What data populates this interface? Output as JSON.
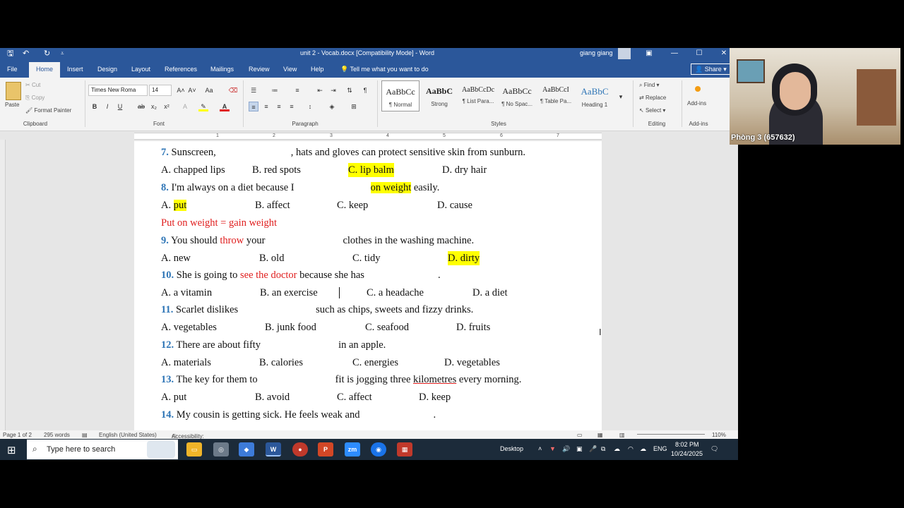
{
  "titlebar": {
    "document_title": "unit 2 - Vocab.docx [Compatibility Mode]  -  Word",
    "user_name": "giang giang",
    "save_icon": "save-icon",
    "undo_icon": "undo-icon",
    "redo_icon": "redo-icon",
    "minimize": "—",
    "maximize": "☐",
    "close": "✕"
  },
  "tabs": [
    "File",
    "Home",
    "Insert",
    "Design",
    "Layout",
    "References",
    "Mailings",
    "Review",
    "View",
    "Help"
  ],
  "tell_me": "Tell me what you want to do",
  "share_label": "Share",
  "ribbon": {
    "clipboard": {
      "paste": "Paste",
      "cut": "Cut",
      "copy": "Copy",
      "format_painter": "Format Painter",
      "group": "Clipboard"
    },
    "font": {
      "name": "Times New Roma",
      "size": "14",
      "group": "Font"
    },
    "paragraph": {
      "group": "Paragraph"
    },
    "styles": {
      "group": "Styles",
      "tiles": [
        {
          "preview": "AaBbCc",
          "name": "¶ Normal"
        },
        {
          "preview": "AaBbC",
          "name": "Strong"
        },
        {
          "preview": "AaBbCcDc",
          "name": "¶ List Para..."
        },
        {
          "preview": "AaBbCc",
          "name": "¶ No Spac..."
        },
        {
          "preview": "AaBbCcI",
          "name": "¶ Table Pa..."
        },
        {
          "preview": "AaBbC",
          "name": "Heading 1"
        }
      ]
    },
    "editing": {
      "find": "Find",
      "replace": "Replace",
      "select": "Select",
      "group": "Editing"
    },
    "addins": {
      "label": "Add-ins",
      "group": "Add-ins"
    }
  },
  "ruler_numbers": [
    "1",
    "2",
    "3",
    "4",
    "5",
    "6",
    "7"
  ],
  "document": {
    "q7": {
      "num": "7.",
      "before": " Sunscreen,",
      "after": ", hats and gloves can protect sensitive skin from sunburn."
    },
    "q7_options": [
      "A. chapped lips",
      "B. red spots",
      "C. lip balm",
      "D. dry hair"
    ],
    "q8": {
      "num": "8.",
      "before": " I'm always on a diet because I",
      "highlight": "on weight",
      "after": " easily."
    },
    "q8_options": {
      "a_prefix": "A. ",
      "a_highlight": "put",
      "b": "B. affect",
      "c": "C. keep",
      "d": "D. cause"
    },
    "note": "Put on weight = gain weight",
    "q9": {
      "num": "9.",
      "before": " You should ",
      "red": "throw",
      "mid": " your",
      "after": "clothes in the washing machine."
    },
    "q9_options": [
      "A. new",
      "B. old",
      "C. tidy",
      "D. dirty"
    ],
    "q10": {
      "num": "10.",
      "before": " She is going to ",
      "red": "see the doctor",
      "after": " because she has",
      "end": "."
    },
    "q10_options": [
      "A. a vitamin",
      "B. an exercise",
      "C. a headache",
      "D. a diet"
    ],
    "q11": {
      "num": "11.",
      "before": " Scarlet dislikes",
      "after": "such as chips, sweets and fizzy drinks."
    },
    "q11_options": [
      "A. vegetables",
      "B. junk food",
      "C. seafood",
      "D. fruits"
    ],
    "q12": {
      "num": "12.",
      "before": " There are about fifty",
      "after": "in an apple."
    },
    "q12_options": [
      "A. materials",
      "B. calories",
      "C. energies",
      "D. vegetables"
    ],
    "q13": {
      "num": "13.",
      "before": " The key for them to",
      "after_pre": "fit is jogging three ",
      "underlined": "kilometres",
      "after_post": " every morning."
    },
    "q13_options": [
      "A. put",
      "B. avoid",
      "C. affect",
      "D. keep"
    ],
    "q14": {
      "num": "14.",
      "before": " My cousin is getting sick. He feels weak and",
      "end": "."
    }
  },
  "statusbar": {
    "page": "Page 1 of 2",
    "words": "295 words",
    "language": "English (United States)",
    "accessibility": "Accessibility: Unavailable",
    "zoom": "110%"
  },
  "taskbar": {
    "search_placeholder": "Type here to search",
    "apps": [
      "file-explorer",
      "app-2",
      "copilot",
      "word",
      "app-5",
      "powerpoint",
      "zoom",
      "chrome",
      "app-9"
    ],
    "desktop": "Desktop",
    "language": "ENG",
    "time": "8:02 PM",
    "date": "10/24/2025"
  },
  "webcam": {
    "participant": "Phòng 3 (657632)"
  },
  "colors": {
    "word_blue": "#2b579a",
    "question_number": "#2e75b6",
    "highlight": "#ffff00",
    "note_red": "#e02020"
  }
}
